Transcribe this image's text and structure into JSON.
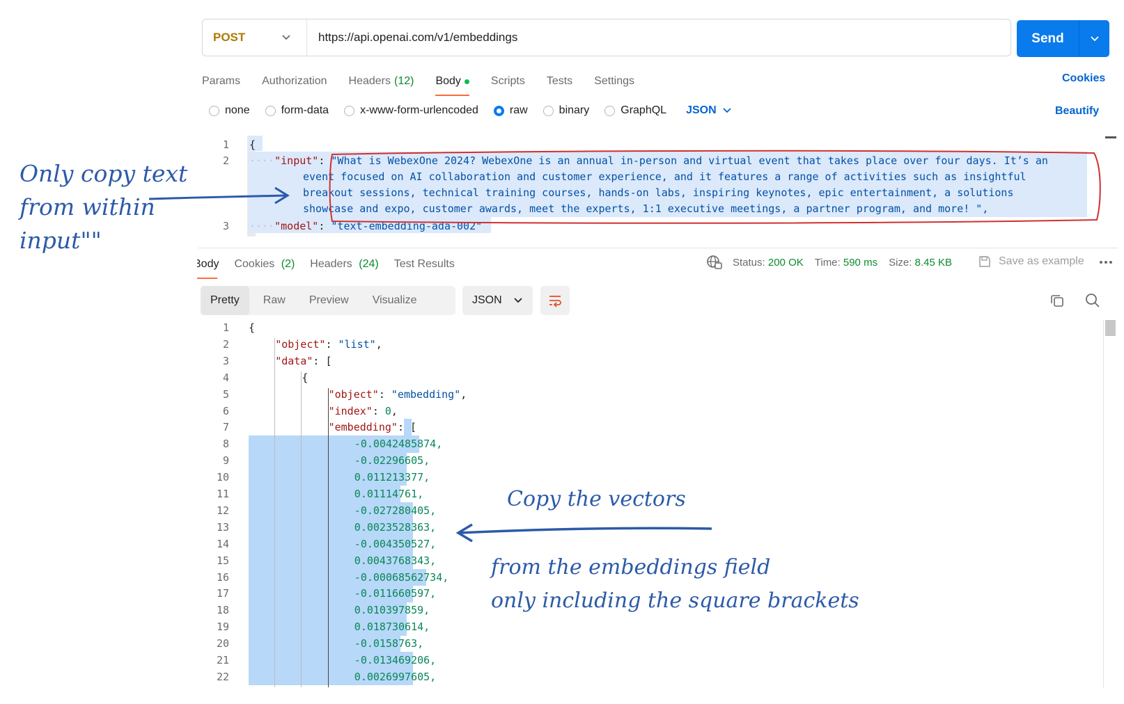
{
  "request": {
    "method": "POST",
    "url": "https://api.openai.com/v1/embeddings",
    "send_label": "Send"
  },
  "request_tabs": [
    {
      "label": "Params"
    },
    {
      "label": "Authorization"
    },
    {
      "label": "Headers",
      "count": "(12)"
    },
    {
      "label": "Body"
    },
    {
      "label": "Scripts"
    },
    {
      "label": "Tests"
    },
    {
      "label": "Settings"
    }
  ],
  "cookies_label": "Cookies",
  "body_types": [
    "none",
    "form-data",
    "x-www-form-urlencoded",
    "raw",
    "binary",
    "GraphQL"
  ],
  "body_format": "JSON",
  "beautify_label": "Beautify",
  "request_body": {
    "line_numbers": [
      "1",
      "2",
      "3"
    ],
    "open_brace": "{",
    "input_key": "\"input\"",
    "input_lines": [
      "\"What is WebexOne 2024? WebexOne is an annual in-person and virtual event that takes place over four days. It’s an",
      "event focused on AI collaboration and customer experience, and it features a range of activities such as insightful",
      "breakout sessions, technical training courses, hands-on labs, inspiring keynotes, epic entertainment, a solutions",
      "showcase and expo, customer awards, meet the experts, 1:1 executive meetings, a partner program, and more! \","
    ],
    "model_key": "\"model\"",
    "model_value": "\"text-embedding-ada-002\""
  },
  "response_tabs": [
    {
      "label": "Body"
    },
    {
      "label": "Cookies",
      "count": "(2)"
    },
    {
      "label": "Headers",
      "count": "(24)"
    },
    {
      "label": "Test Results"
    }
  ],
  "response_status": {
    "status_label": "Status:",
    "status_value": "200 OK",
    "time_label": "Time:",
    "time_value": "590 ms",
    "size_label": "Size:",
    "size_value": "8.45 KB"
  },
  "save_example_label": "Save as example",
  "view_modes": [
    "Pretty",
    "Raw",
    "Preview",
    "Visualize"
  ],
  "response_format": "JSON",
  "response_body": {
    "line_numbers": [
      "1",
      "2",
      "3",
      "4",
      "5",
      "6",
      "7",
      "8",
      "9",
      "10",
      "11",
      "12",
      "13",
      "14",
      "15",
      "16",
      "17",
      "18",
      "19",
      "20",
      "21",
      "22"
    ],
    "header_lines": [
      {
        "indent": 0,
        "text": "{"
      },
      {
        "indent": 1,
        "key": "\"object\"",
        "value": "\"list\"",
        "end": ","
      },
      {
        "indent": 1,
        "key": "\"data\"",
        "value": "[",
        "end": ""
      },
      {
        "indent": 2,
        "text": "{"
      },
      {
        "indent": 3,
        "key": "\"object\"",
        "value": "\"embedding\"",
        "end": ","
      },
      {
        "indent": 3,
        "key": "\"index\"",
        "num": "0",
        "end": ","
      },
      {
        "indent": 3,
        "key": "\"embedding\"",
        "value": "[",
        "end": ""
      }
    ],
    "embedding_values": [
      "-0.0042485874,",
      "-0.02296605,",
      "0.011213377,",
      "0.01114761,",
      "-0.027280405,",
      "0.0023528363,",
      "-0.004350527,",
      "0.0043768343,",
      "-0.00068562734,",
      "-0.011660597,",
      "0.010397859,",
      "0.018730614,",
      "-0.0158763,",
      "-0.013469206,",
      "0.0026997605,"
    ]
  },
  "annotations": {
    "left_lines": [
      "Only copy text",
      "from within",
      "input\"\""
    ],
    "copy_vectors": "Copy the vectors",
    "from_lines": [
      "from the embeddings field",
      "only including the square brackets"
    ],
    "color": "#2c5aa8",
    "box_color": "#d0302f"
  },
  "colors": {
    "accent": "#097bed",
    "method": "#ad7a03",
    "active_tab_underline": "#ff6c37",
    "status_ok": "#0b8a2d",
    "selection": "#b7d8f8"
  }
}
